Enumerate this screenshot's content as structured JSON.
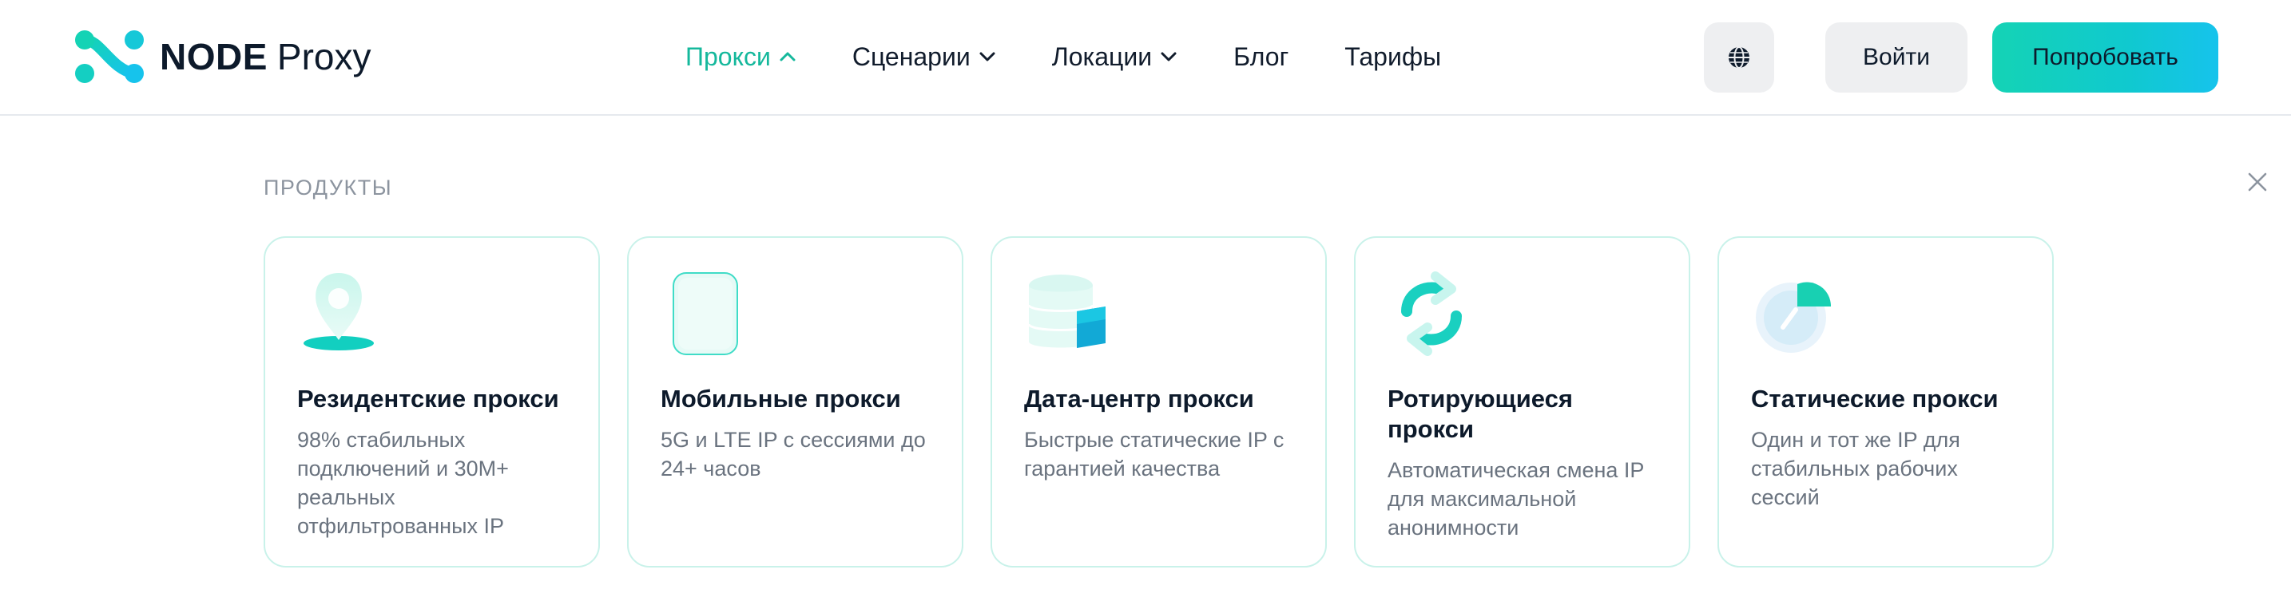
{
  "brand": {
    "bold": "NODE",
    "light": "Proxy"
  },
  "nav": [
    {
      "label": "Прокси",
      "active": true,
      "dropdown": "up"
    },
    {
      "label": "Сценарии",
      "active": false,
      "dropdown": "down"
    },
    {
      "label": "Локации",
      "active": false,
      "dropdown": "down"
    },
    {
      "label": "Блог",
      "active": false
    },
    {
      "label": "Тарифы",
      "active": false
    }
  ],
  "header_actions": {
    "login_label": "Войти",
    "try_label": "Попробовать"
  },
  "panel": {
    "section_label": "ПРОДУКТЫ"
  },
  "products": [
    {
      "icon": "location-pin-icon",
      "title": "Резидентские прокси",
      "description": "98% стабильных подключений и 30M+ реальных отфильтрованных IP"
    },
    {
      "icon": "mobile-phone-icon",
      "title": "Мобильные прокси",
      "description": "5G и LTE IP с сессиями до 24+ часов"
    },
    {
      "icon": "database-icon",
      "title": "Дата-центр прокси",
      "description": "Быстрые статические IP с гарантией качества"
    },
    {
      "icon": "rotate-arrows-icon",
      "title": "Ротирующиеся прокси",
      "description": "Автоматическая смена IP для максимальной анонимности"
    },
    {
      "icon": "static-pie-icon",
      "title": "Статические прокси",
      "description": "Один и тот же IP для стабильных рабочих сессий"
    }
  ],
  "colors": {
    "accent": "#15b89c",
    "cta_gradient_start": "#14d3b5",
    "cta_gradient_end": "#16c3ec",
    "card_border": "#c9f2ea",
    "button_gray": "#eeeff1"
  }
}
